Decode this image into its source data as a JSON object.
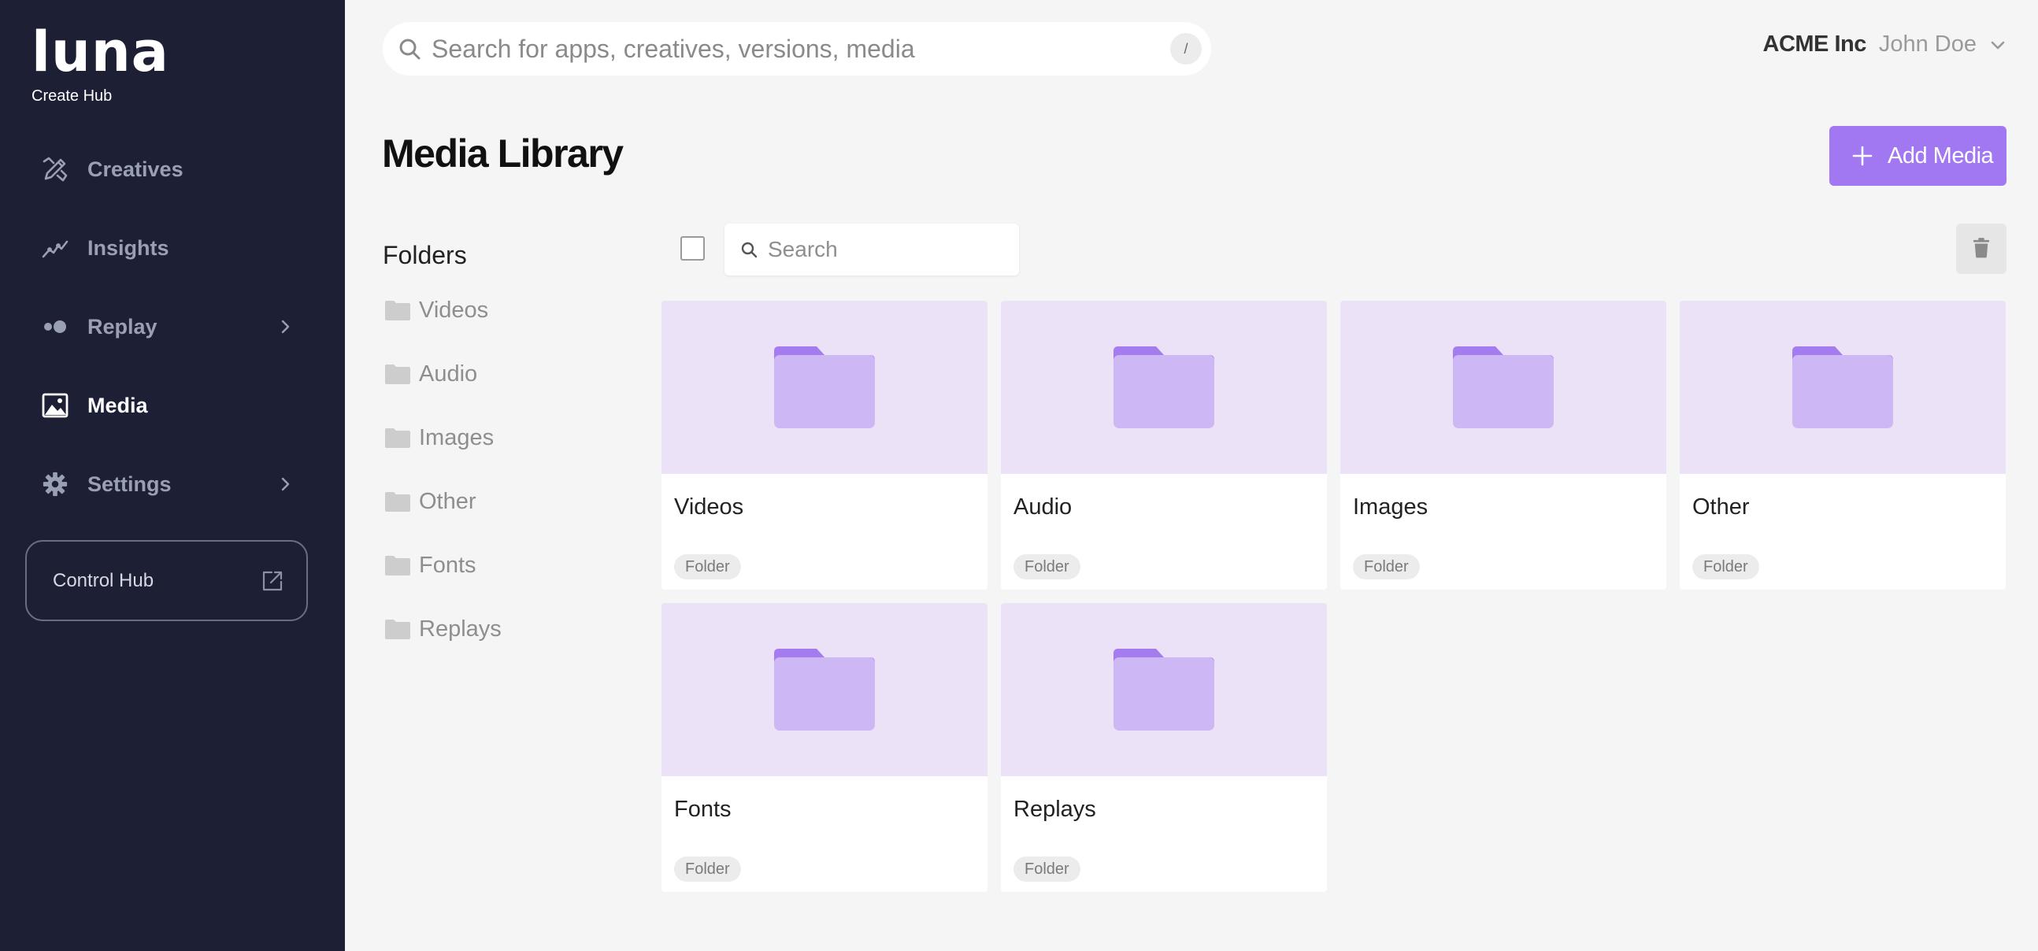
{
  "brand": {
    "logo": "luna",
    "subtitle": "Create Hub"
  },
  "sidebar": {
    "items": [
      {
        "label": "Creatives",
        "icon": "pencil-ruler-icon",
        "active": false,
        "has_submenu": false
      },
      {
        "label": "Insights",
        "icon": "trend-line-icon",
        "active": false,
        "has_submenu": false
      },
      {
        "label": "Replay",
        "icon": "replay-dots-icon",
        "active": false,
        "has_submenu": true
      },
      {
        "label": "Media",
        "icon": "image-icon",
        "active": true,
        "has_submenu": false
      },
      {
        "label": "Settings",
        "icon": "gear-icon",
        "active": false,
        "has_submenu": true
      }
    ],
    "control_hub": {
      "label": "Control Hub",
      "icon": "external-link-icon"
    }
  },
  "topbar": {
    "search_placeholder": "Search for apps, creatives, versions, media",
    "shortcut": "/",
    "org": "ACME Inc",
    "user": "John Doe"
  },
  "page": {
    "title": "Media Library",
    "add_button": "Add Media"
  },
  "folder_tree": {
    "heading": "Folders",
    "items": [
      "Videos",
      "Audio",
      "Images",
      "Other",
      "Fonts",
      "Replays"
    ]
  },
  "toolbar": {
    "search_placeholder": "Search"
  },
  "cards": [
    {
      "title": "Videos",
      "type": "Folder"
    },
    {
      "title": "Audio",
      "type": "Folder"
    },
    {
      "title": "Images",
      "type": "Folder"
    },
    {
      "title": "Other",
      "type": "Folder"
    },
    {
      "title": "Fonts",
      "type": "Folder"
    },
    {
      "title": "Replays",
      "type": "Folder"
    }
  ],
  "colors": {
    "sidebar_bg": "#1d1f35",
    "accent": "#a277f2",
    "thumb_bg": "#ebe2f8",
    "folder_front": "#cdb8f5",
    "folder_back": "#a57cf0",
    "page_bg": "#f4f5f4"
  }
}
